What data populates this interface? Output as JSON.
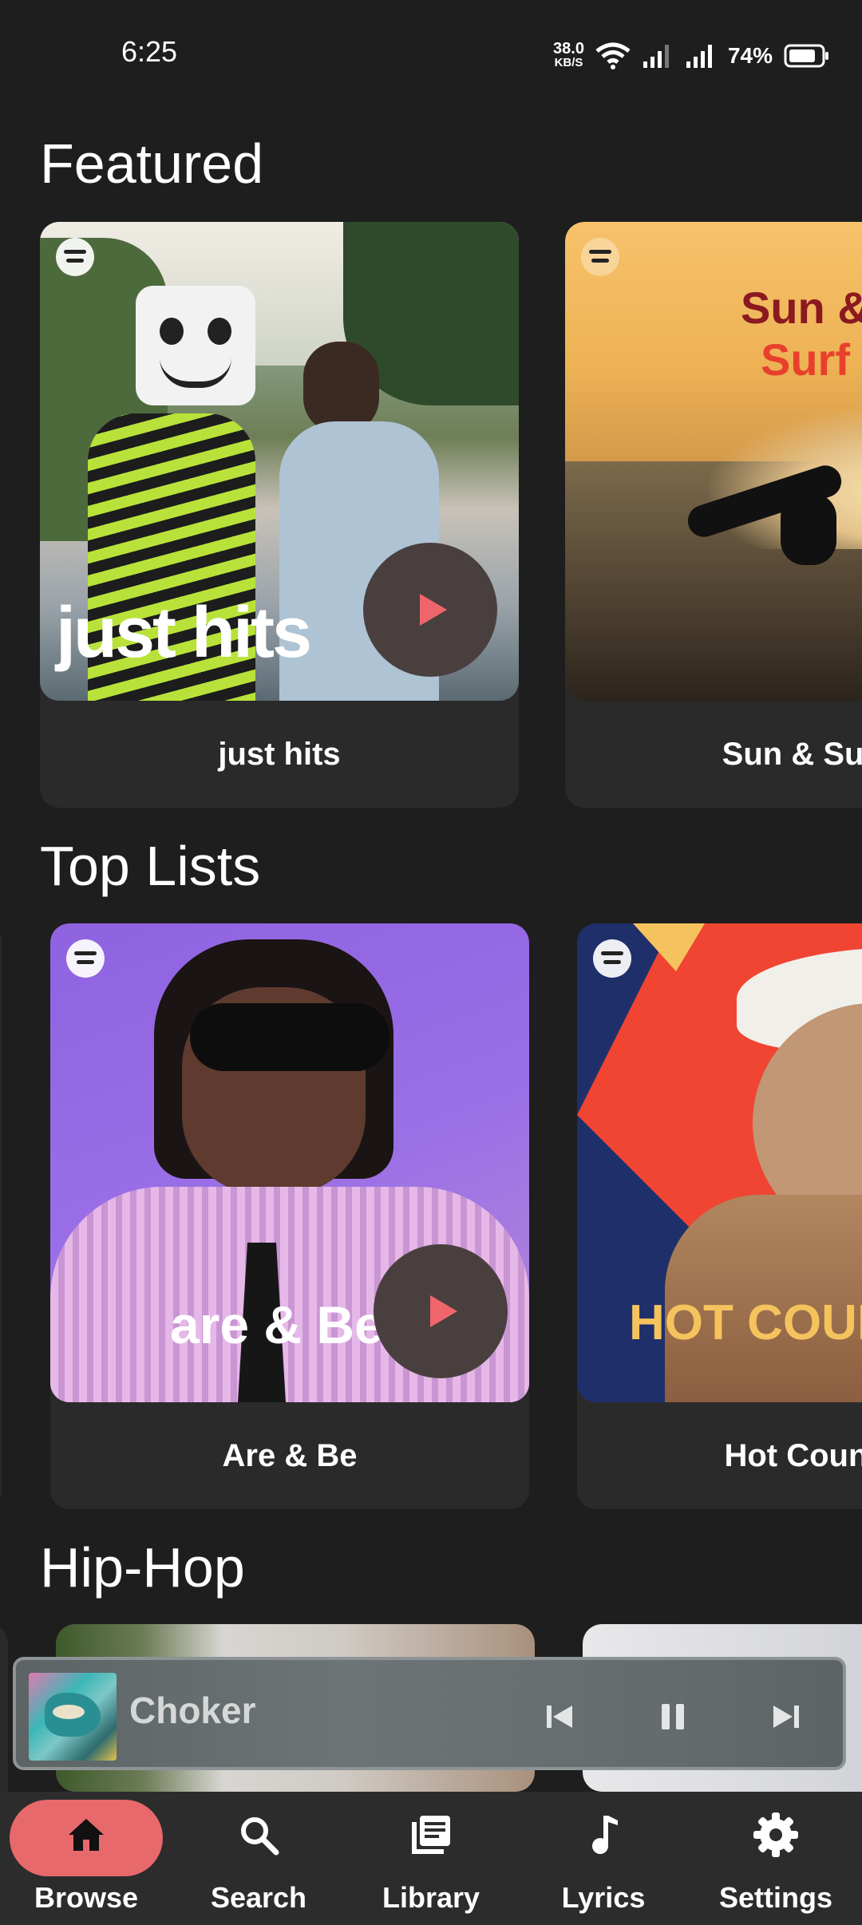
{
  "status": {
    "time": "6:25",
    "net_speed_value": "38.0",
    "net_speed_unit": "KB/S",
    "battery": "74%"
  },
  "sections": {
    "featured": {
      "title": "Featured",
      "cards": [
        {
          "label": "just hits",
          "cover_text": "just hits"
        },
        {
          "label": "Sun & Surf",
          "cover_text_line1": "Sun &",
          "cover_text_line2": "Surf"
        }
      ]
    },
    "top_lists": {
      "title": "Top Lists",
      "cards": [
        {
          "label": "Are & Be",
          "cover_text": "are & Be"
        },
        {
          "label": "Hot Country",
          "cover_text": "HOT COUNTRY"
        }
      ]
    },
    "hip_hop": {
      "title": "Hip-Hop"
    }
  },
  "player": {
    "track_title": "Choker"
  },
  "nav": {
    "items": [
      {
        "label": "Browse",
        "icon": "home-icon",
        "active": true
      },
      {
        "label": "Search",
        "icon": "search-icon",
        "active": false
      },
      {
        "label": "Library",
        "icon": "library-icon",
        "active": false
      },
      {
        "label": "Lyrics",
        "icon": "music-note-icon",
        "active": false
      },
      {
        "label": "Settings",
        "icon": "gear-icon",
        "active": false
      }
    ]
  },
  "colors": {
    "background": "#1e1e1e",
    "card": "#2a2a2a",
    "accent": "#f0656c",
    "nav_active": "#e8696b",
    "nav_bg": "#2c2c2c"
  }
}
